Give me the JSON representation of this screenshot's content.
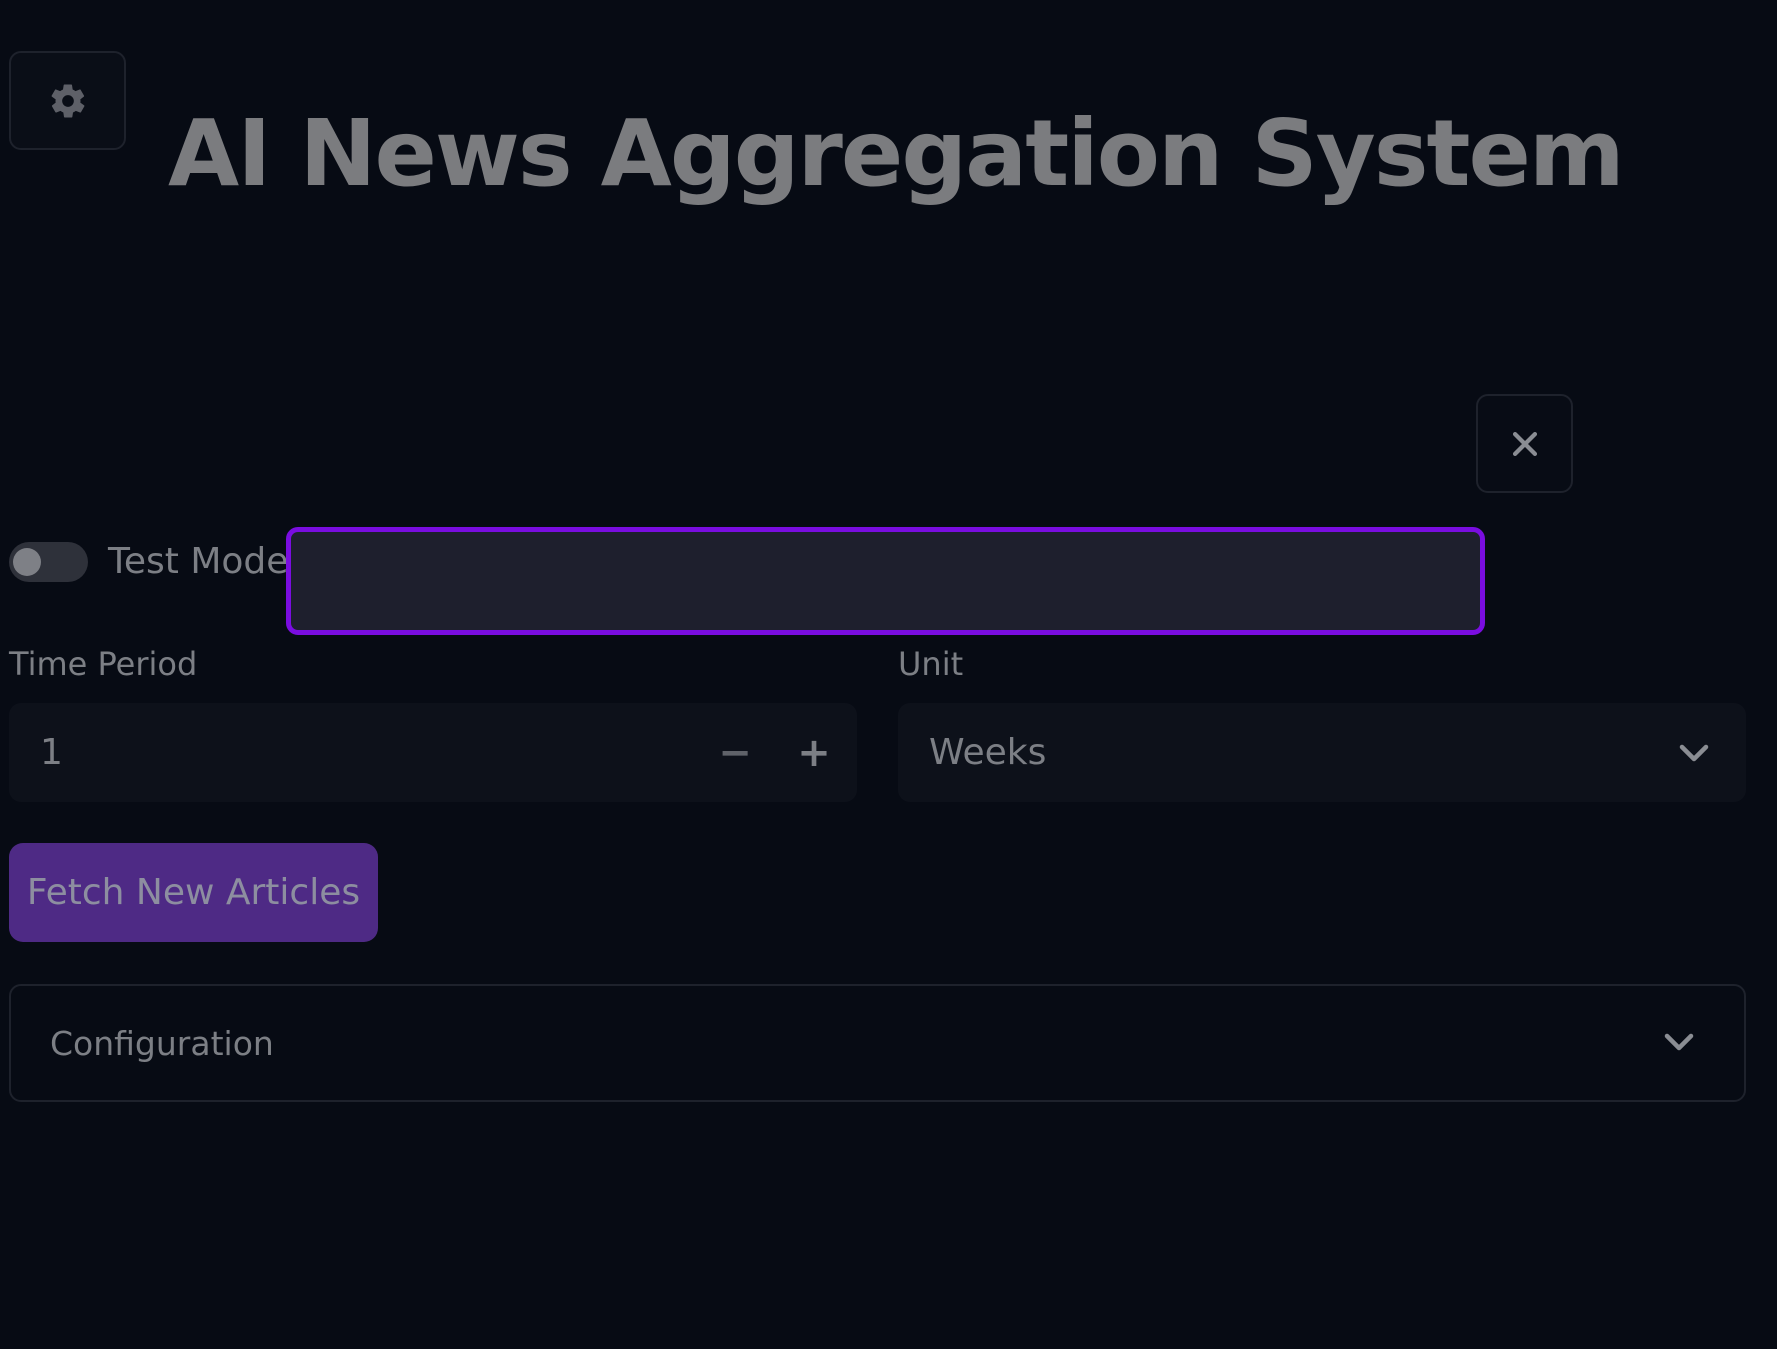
{
  "header": {
    "title": "AI News Aggregation System",
    "settings_icon": "gear-icon",
    "close_icon": "close-icon"
  },
  "test_mode": {
    "label": "Test Mode",
    "enabled": false,
    "input_value": ""
  },
  "time_period": {
    "label": "Time Period",
    "value": "1",
    "decrement_icon": "minus-icon",
    "increment_icon": "plus-icon"
  },
  "unit": {
    "label": "Unit",
    "selected": "Weeks",
    "chevron_icon": "chevron-down-icon"
  },
  "actions": {
    "fetch_label": "Fetch New Articles"
  },
  "configuration": {
    "label": "Configuration",
    "chevron_icon": "chevron-down-icon"
  },
  "colors": {
    "background": "#070b14",
    "accent": "#7a0de0",
    "button": "#4e2a85",
    "text": "#7c7f85"
  }
}
